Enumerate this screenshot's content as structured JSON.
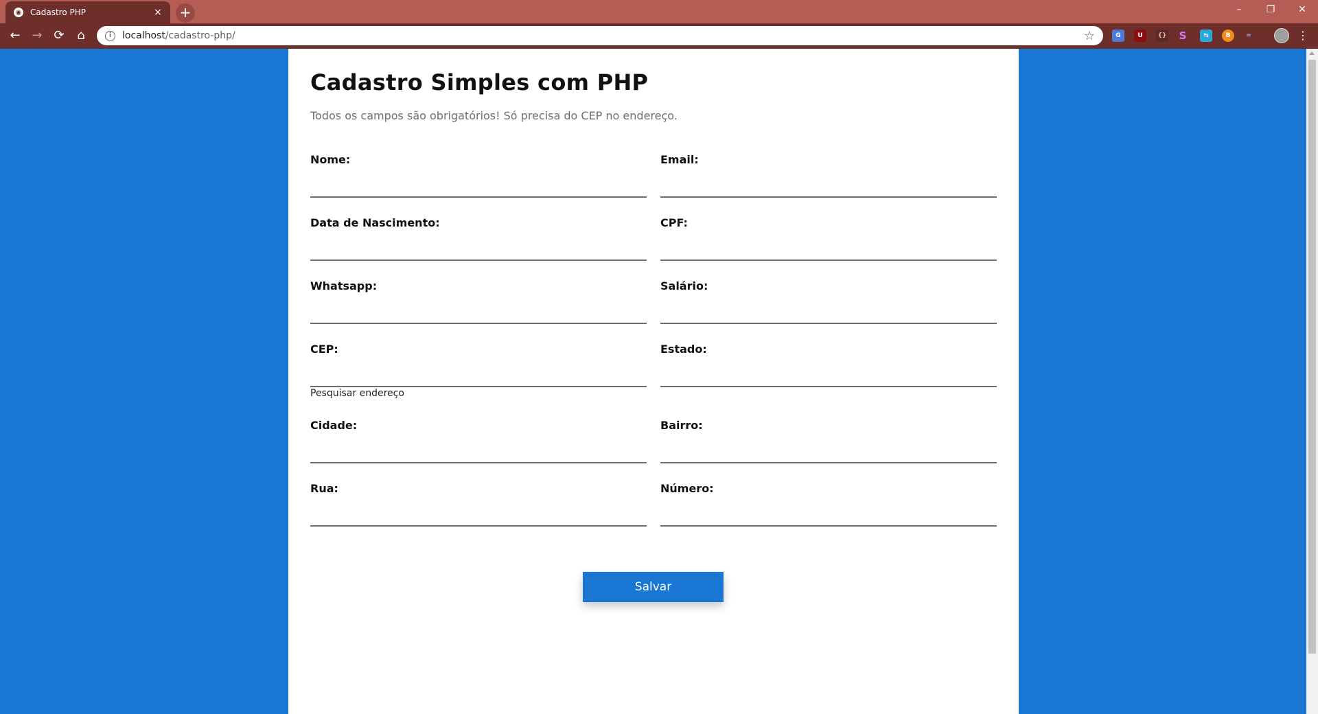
{
  "browser": {
    "tab_title": "Cadastro PHP",
    "tab_close": "×",
    "new_tab": "+",
    "url_host": "localhost",
    "url_path": "/cadastro-php/",
    "window_controls": {
      "minimize": "–",
      "restore": "❐",
      "close": "✕"
    },
    "nav": {
      "back": "←",
      "forward": "→",
      "reload": "⟳",
      "home": "⌂"
    }
  },
  "page": {
    "title": "Cadastro Simples com PHP",
    "subtitle": "Todos os campos são obrigatórios! Só precisa do CEP no endereço.",
    "fields": {
      "nome": "Nome:",
      "email": "Email:",
      "nascimento": "Data de Nascimento:",
      "cpf": "CPF:",
      "whatsapp": "Whatsapp:",
      "salario": "Salário:",
      "cep": "CEP:",
      "estado": "Estado:",
      "cidade": "Cidade:",
      "bairro": "Bairro:",
      "rua": "Rua:",
      "numero": "Número:"
    },
    "search_address_link": "Pesquisar endereço",
    "save_button": "Salvar"
  },
  "colors": {
    "page_background": "#1976d2",
    "button": "#1976d2",
    "tab_strip": "#b55d55",
    "toolbar": "#6e2f2b"
  }
}
